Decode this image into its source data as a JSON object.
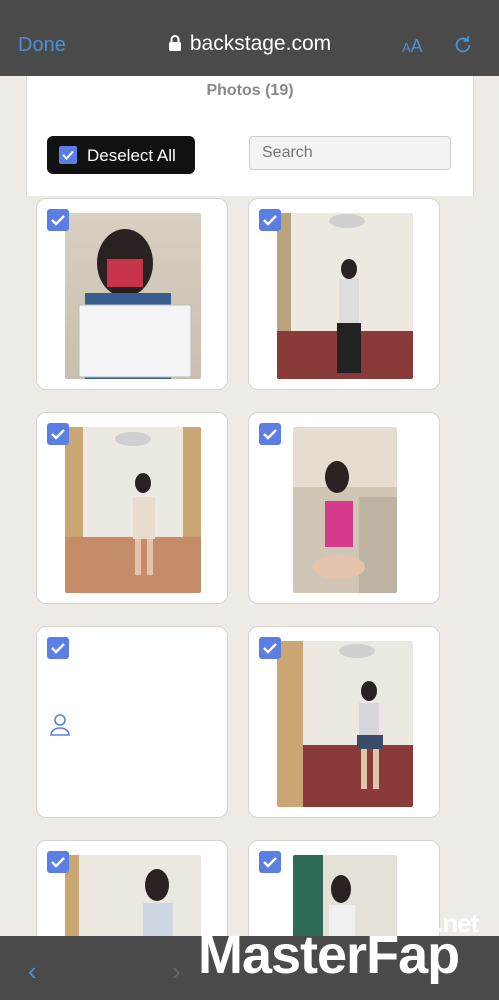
{
  "browser": {
    "done_label": "Done",
    "url": "backstage.com",
    "text_size_label": "AA",
    "reload_icon": "reload-icon"
  },
  "header": {
    "photos_title": "Photos (19)",
    "deselect_label": "Deselect All",
    "search_placeholder": "Search"
  },
  "watermark": {
    "text_a": "Master",
    "text_b": "Fap",
    "suffix": ".net"
  }
}
